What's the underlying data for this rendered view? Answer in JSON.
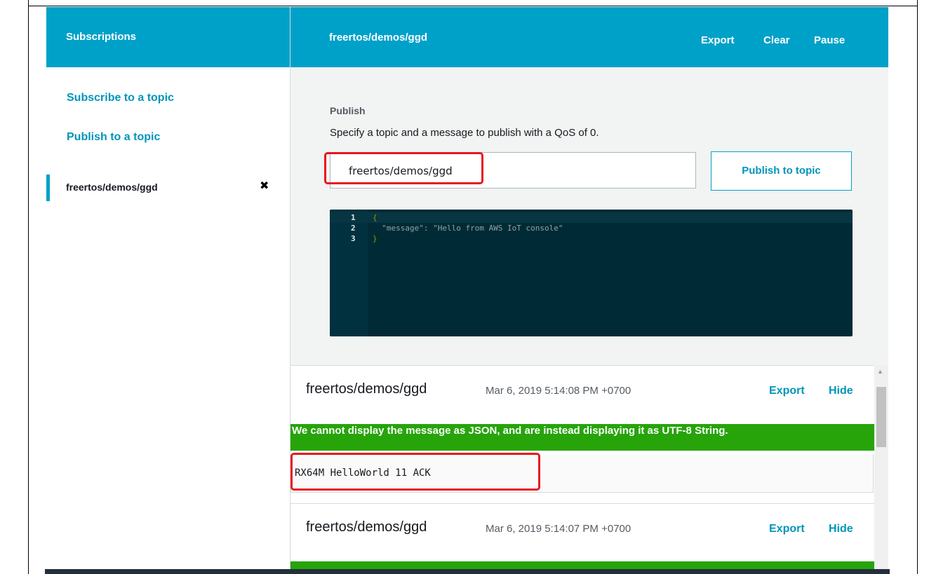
{
  "sidebar": {
    "title": "Subscriptions",
    "links": {
      "subscribe": "Subscribe to a topic",
      "publish": "Publish to a topic"
    },
    "subscriptions": [
      {
        "topic": "freertos/demos/ggd",
        "close_glyph": "✖"
      }
    ]
  },
  "main": {
    "title": "freertos/demos/ggd",
    "actions": {
      "export": "Export",
      "clear": "Clear",
      "pause": "Pause"
    },
    "publish": {
      "label": "Publish",
      "description": "Specify a topic and a message to publish with a QoS of 0.",
      "topic_value": "freertos/demos/ggd",
      "button_label": "Publish to topic"
    },
    "editor": {
      "lines": [
        {
          "num": "1",
          "code": "{"
        },
        {
          "num": "2",
          "code": "  \"message\": \"Hello from AWS IoT console\""
        },
        {
          "num": "3",
          "code": "}"
        }
      ]
    },
    "messages": [
      {
        "topic": "freertos/demos/ggd",
        "timestamp": "Mar 6, 2019 5:14:08 PM +0700",
        "export_label": "Export",
        "hide_label": "Hide",
        "notice": "We cannot display the message as JSON, and are instead displaying it as UTF-8 String.",
        "payload": "RX64M HelloWorld 11 ACK"
      },
      {
        "topic": "freertos/demos/ggd",
        "timestamp": "Mar 6, 2019 5:14:07 PM +0700",
        "export_label": "Export",
        "hide_label": "Hide"
      }
    ]
  },
  "colors": {
    "header": "#00a1c9",
    "link": "#0095b9",
    "success_banner": "#26a40a",
    "annotation": "#e8171f",
    "editor_bg": "#002b36"
  },
  "icons": {
    "close": "close-icon",
    "scroll_up": "chevron-up-icon"
  }
}
